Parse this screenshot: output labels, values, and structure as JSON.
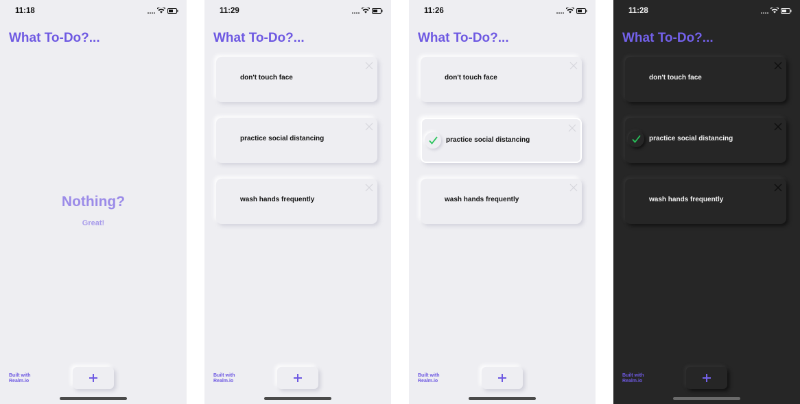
{
  "app": {
    "title": "What To-Do?...",
    "built_with": [
      "Built with",
      "Realm.io"
    ],
    "accent_color": "#6e59e2",
    "check_color": "#27c45a"
  },
  "screens": [
    {
      "theme": "light",
      "time": "11:18",
      "empty_state": {
        "title": "Nothing?",
        "subtitle": "Great!"
      },
      "items": []
    },
    {
      "theme": "light",
      "time": "11:29",
      "items": [
        {
          "label": "don't touch face",
          "done": false
        },
        {
          "label": "practice social distancing",
          "done": false
        },
        {
          "label": "wash hands frequently",
          "done": false
        }
      ]
    },
    {
      "theme": "light",
      "time": "11:26",
      "items": [
        {
          "label": "don't touch face",
          "done": false
        },
        {
          "label": "practice social distancing",
          "done": true
        },
        {
          "label": "wash hands frequently",
          "done": false
        }
      ]
    },
    {
      "theme": "dark",
      "time": "11:28",
      "items": [
        {
          "label": "don't touch face",
          "done": false
        },
        {
          "label": "practice social distancing",
          "done": true
        },
        {
          "label": "wash hands frequently",
          "done": false
        }
      ]
    }
  ],
  "icons": {
    "add": "plus-icon",
    "delete": "close-icon",
    "check": "checkmark-icon",
    "wifi": "wifi-icon",
    "battery": "battery-icon",
    "signal": "signal-icon"
  }
}
